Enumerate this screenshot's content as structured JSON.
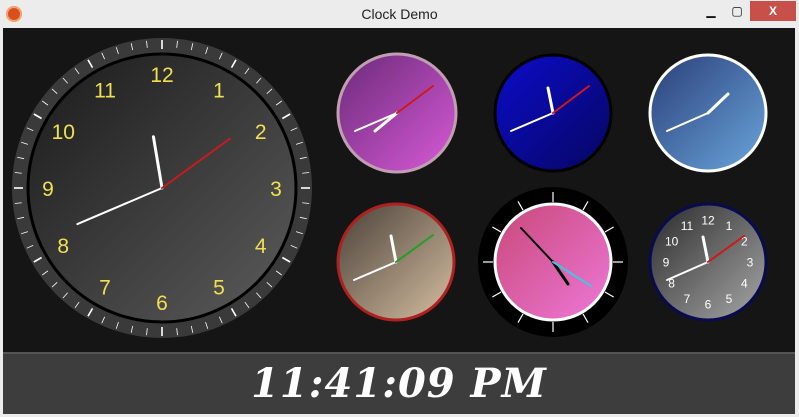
{
  "window": {
    "title": "Clock Demo",
    "minimize_label": "▁",
    "maximize_label": "▢",
    "close_label": "X"
  },
  "main_clock": {
    "numbers": [
      "12",
      "1",
      "2",
      "3",
      "4",
      "5",
      "6",
      "7",
      "8",
      "9",
      "10",
      "11"
    ],
    "number_color": "#f0e050"
  },
  "small_clock": {
    "numbers": [
      "12",
      "1",
      "2",
      "3",
      "4",
      "5",
      "6",
      "7",
      "8",
      "9",
      "10",
      "11"
    ]
  },
  "time": {
    "hour": 11,
    "minute": 41,
    "second": 9
  },
  "digital_time": "11:41:09 PM",
  "colors": {
    "second_hand_main": "#d01818",
    "purple_face": "#a040b0",
    "blue_face": "#0a0aa0",
    "steel_face": "#3c68a8",
    "sepia_face": "#8a7a68",
    "pink_face": "#e060a0",
    "gray_face": "#707070",
    "green_second": "#22a022",
    "cyan_second": "#40c8e0"
  }
}
